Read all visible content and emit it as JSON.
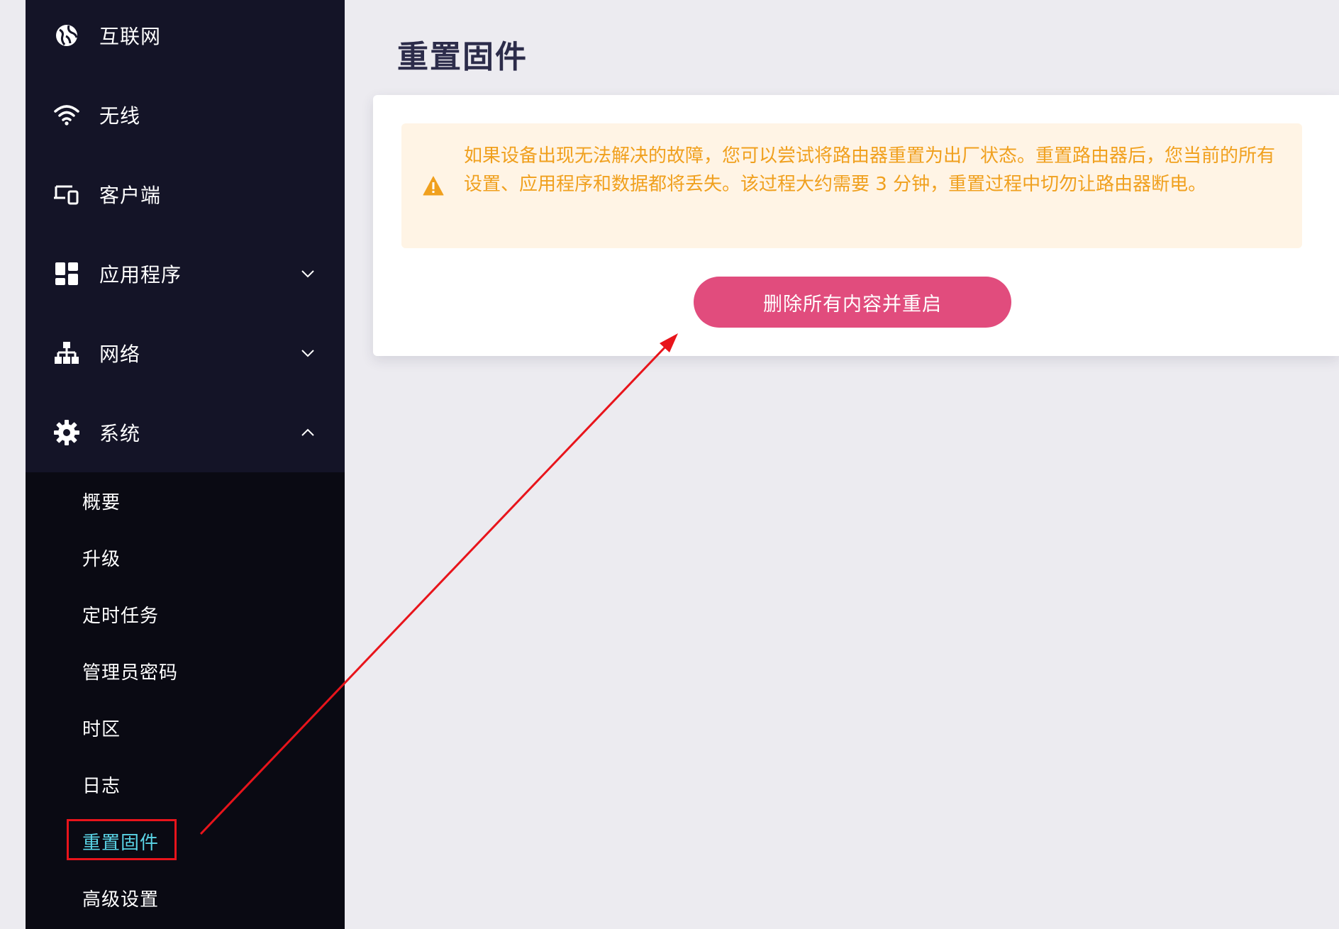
{
  "sidebar": {
    "items": [
      {
        "label": "互联网",
        "icon": "globe-icon"
      },
      {
        "label": "无线",
        "icon": "wifi-icon"
      },
      {
        "label": "客户端",
        "icon": "devices-icon"
      },
      {
        "label": "应用程序",
        "icon": "apps-icon",
        "expanded": false
      },
      {
        "label": "网络",
        "icon": "network-icon",
        "expanded": false
      },
      {
        "label": "系统",
        "icon": "gear-icon",
        "expanded": true
      }
    ],
    "submenu": [
      {
        "label": "概要"
      },
      {
        "label": "升级"
      },
      {
        "label": "定时任务"
      },
      {
        "label": "管理员密码"
      },
      {
        "label": "时区"
      },
      {
        "label": "日志"
      },
      {
        "label": "重置固件",
        "active": true
      },
      {
        "label": "高级设置"
      }
    ]
  },
  "main": {
    "title": "重置固件",
    "alert": {
      "icon": "warning-icon",
      "message": "如果设备出现无法解决的故障，您可以尝试将路由器重置为出厂状态。重置路由器后，您当前的所有设置、应用程序和数据都将丢失。该过程大约需要 3 分钟，重置过程中切勿让路由器断电。"
    },
    "reset_button_label": "删除所有内容并重启"
  },
  "colors": {
    "sidebar_bg": "#141427",
    "submenu_bg": "#0a0a13",
    "active_text": "#5ad4e6",
    "alert_bg": "#fff4e5",
    "alert_text": "#f0a01e",
    "button_bg": "#e14c7d",
    "annotation_red": "#e8141b"
  }
}
